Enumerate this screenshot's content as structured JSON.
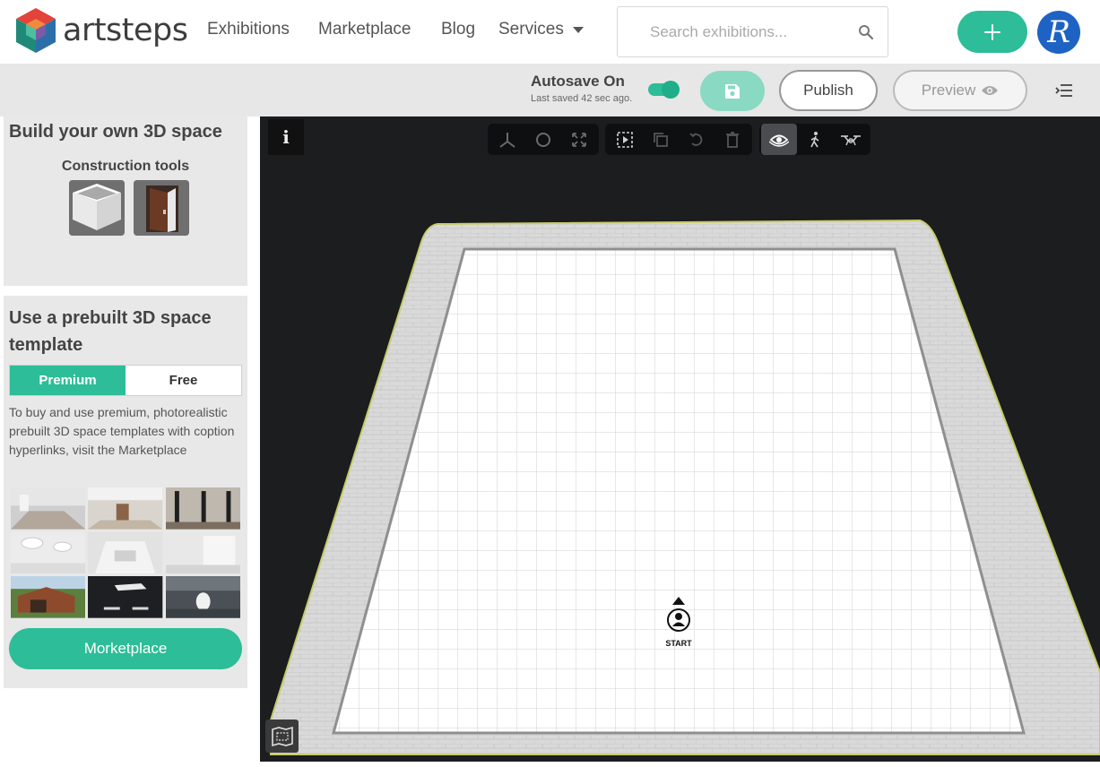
{
  "brand": {
    "name": "artsteps"
  },
  "nav": {
    "exhibitions": "Exhibitions",
    "marketplace": "Marketplace",
    "blog": "Blog",
    "services": "Services"
  },
  "search": {
    "placeholder": "Search exhibitions..."
  },
  "user": {
    "avatar_letter": "R"
  },
  "editor": {
    "autosave_title": "Autosave On",
    "autosave_sub": "Last saved 42 sec ago.",
    "autosave_enabled": true,
    "publish_label": "Publish",
    "preview_label": "Preview"
  },
  "build": {
    "title": "Build your own 3D space",
    "tools_label": "Construction tools",
    "tools": [
      "walls-tool-icon",
      "door-tool-icon"
    ]
  },
  "template": {
    "title": "Use a prebuilt 3D space template",
    "tabs": {
      "premium": "Premium",
      "free": "Free"
    },
    "active_tab": "premium",
    "description": "To buy and use premium, photorealistic prebuilt 3D space templates with coption hyperlinks, visit the Marketplace",
    "marketplace_button": "Morketplace"
  },
  "viewport": {
    "start_label": "START",
    "info_glyph": "i"
  },
  "colors": {
    "accent": "#2dbd98",
    "accent_light": "#8ad9c3",
    "avatar": "#1e63c4",
    "viewport_bg": "#1b1d1f"
  }
}
